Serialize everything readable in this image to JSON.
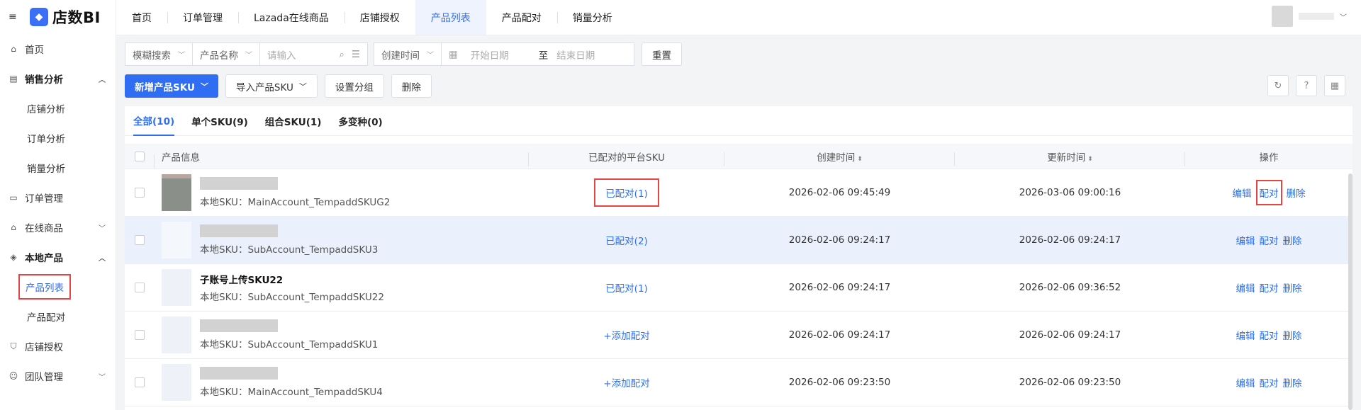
{
  "app": {
    "logo_text": "店数BI"
  },
  "sidebar": {
    "items": [
      {
        "label": "首页",
        "icon": "home-icon"
      },
      {
        "label": "销售分析",
        "icon": "chart-icon",
        "expanded": true
      },
      {
        "label": "店铺分析"
      },
      {
        "label": "订单分析"
      },
      {
        "label": "销量分析"
      },
      {
        "label": "订单管理",
        "icon": "document-icon"
      },
      {
        "label": "在线商品",
        "icon": "store-icon",
        "expanded": false
      },
      {
        "label": "本地产品",
        "icon": "cube-icon",
        "expanded": true
      },
      {
        "label": "产品列表",
        "active": true
      },
      {
        "label": "产品配对"
      },
      {
        "label": "店铺授权",
        "icon": "shield-icon"
      },
      {
        "label": "团队管理",
        "icon": "team-icon",
        "expanded": false
      }
    ]
  },
  "topnav": {
    "tabs": [
      "首页",
      "订单管理",
      "Lazada在线商品",
      "店铺授权",
      "产品列表",
      "产品配对",
      "销量分析"
    ],
    "active_index": 4
  },
  "filters": {
    "search_mode": "模糊搜索",
    "field": "产品名称",
    "input_placeholder": "请输入",
    "time_field": "创建时间",
    "start_placeholder": "开始日期",
    "range_sep": "至",
    "end_placeholder": "结束日期",
    "reset": "重置"
  },
  "toolbar": {
    "add_sku": "新增产品SKU",
    "import_sku": "导入产品SKU",
    "set_group": "设置分组",
    "delete": "删除"
  },
  "subtabs": [
    "全部(10)",
    "单个SKU(9)",
    "组合SKU(1)",
    "多变种(0)"
  ],
  "table": {
    "headers": {
      "info": "产品信息",
      "paired": "已配对的平台SKU",
      "created": "创建时间",
      "updated": "更新时间",
      "ops": "操作"
    },
    "sku_prefix": "本地SKU：",
    "op_edit": "编辑",
    "op_pair": "配对",
    "op_delete": "删除",
    "rows": [
      {
        "name": "",
        "sku": "MainAccount_TempaddSKUG2",
        "paired": "已配对(1)",
        "created": "2026-02-06 09:45:49",
        "updated": "2026-03-06 09:00:16"
      },
      {
        "name": "",
        "sku": "SubAccount_TempaddSKU3",
        "paired": "已配对(2)",
        "created": "2026-02-06 09:24:17",
        "updated": "2026-02-06 09:24:17"
      },
      {
        "name": "子账号上传SKU22",
        "sku": "SubAccount_TempaddSKU22",
        "paired": "已配对(1)",
        "created": "2026-02-06 09:24:17",
        "updated": "2026-02-06 09:36:52"
      },
      {
        "name": "",
        "sku": "SubAccount_TempaddSKU1",
        "paired": "+添加配对",
        "created": "2026-02-06 09:24:17",
        "updated": "2026-02-06 09:24:17"
      },
      {
        "name": "",
        "sku": "MainAccount_TempaddSKU4",
        "paired": "+添加配对",
        "created": "2026-02-06 09:23:50",
        "updated": "2026-02-06 09:23:50"
      }
    ]
  },
  "colors": {
    "accent": "#2f6ef3",
    "highlight_box": "#e54545",
    "row_highlight": "#eaf1fd"
  }
}
